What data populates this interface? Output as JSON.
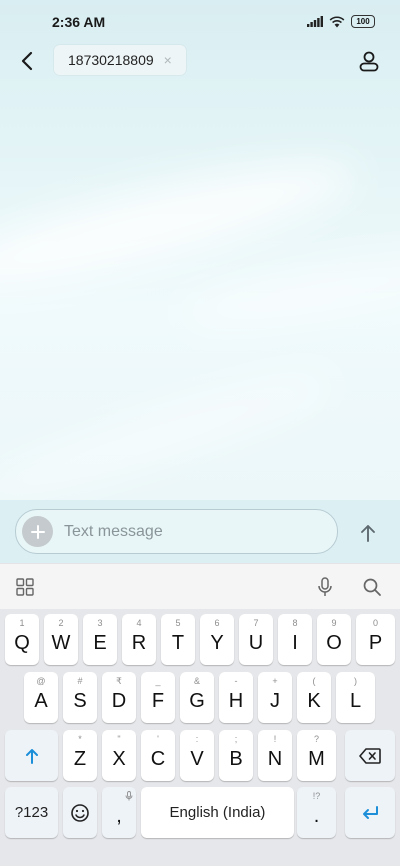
{
  "status_bar": {
    "time": "2:36 AM",
    "battery": "100"
  },
  "header": {
    "recipient_number": "18730218809",
    "chip_close": "×"
  },
  "compose": {
    "placeholder": "Text message"
  },
  "keyboard": {
    "row1": [
      {
        "hint": "1",
        "key": "Q"
      },
      {
        "hint": "2",
        "key": "W"
      },
      {
        "hint": "3",
        "key": "E"
      },
      {
        "hint": "4",
        "key": "R"
      },
      {
        "hint": "5",
        "key": "T"
      },
      {
        "hint": "6",
        "key": "Y"
      },
      {
        "hint": "7",
        "key": "U"
      },
      {
        "hint": "8",
        "key": "I"
      },
      {
        "hint": "9",
        "key": "O"
      },
      {
        "hint": "0",
        "key": "P"
      }
    ],
    "row2": [
      {
        "hint": "@",
        "key": "A"
      },
      {
        "hint": "#",
        "key": "S"
      },
      {
        "hint": "₹",
        "key": "D"
      },
      {
        "hint": "_",
        "key": "F"
      },
      {
        "hint": "&",
        "key": "G"
      },
      {
        "hint": "-",
        "key": "H"
      },
      {
        "hint": "+",
        "key": "J"
      },
      {
        "hint": "(",
        "key": "K"
      },
      {
        "hint": ")",
        "key": "L"
      }
    ],
    "row3": [
      {
        "hint": "*",
        "key": "Z"
      },
      {
        "hint": "\"",
        "key": "X"
      },
      {
        "hint": "'",
        "key": "C"
      },
      {
        "hint": ":",
        "key": "V"
      },
      {
        "hint": ";",
        "key": "B"
      },
      {
        "hint": "!",
        "key": "N"
      },
      {
        "hint": "?",
        "key": "M"
      }
    ],
    "symbols_key": "?123",
    "comma_key": ",",
    "space_key": "English (India)",
    "period_key": ".",
    "period_hint": "!?"
  }
}
